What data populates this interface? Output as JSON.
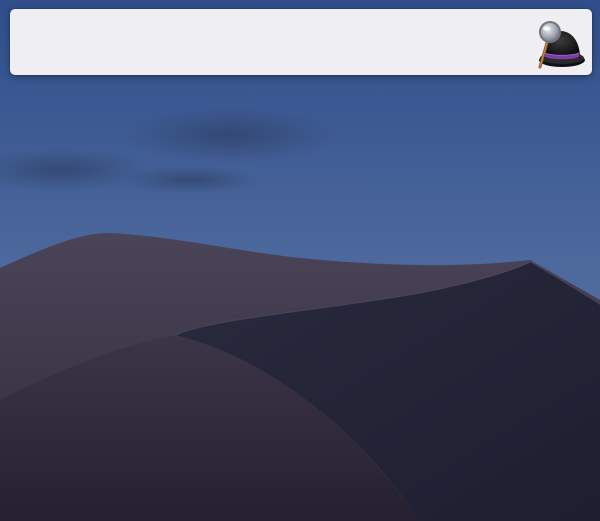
{
  "launcher": {
    "query": "",
    "placeholder": "",
    "logo_icon": "hat-with-magnifier-icon"
  },
  "colors": {
    "sky_top": "#2e4e8a",
    "sky_bottom": "#5f79a6",
    "panel_background": "#efeff3",
    "hat_band": "#7b3fa6"
  }
}
